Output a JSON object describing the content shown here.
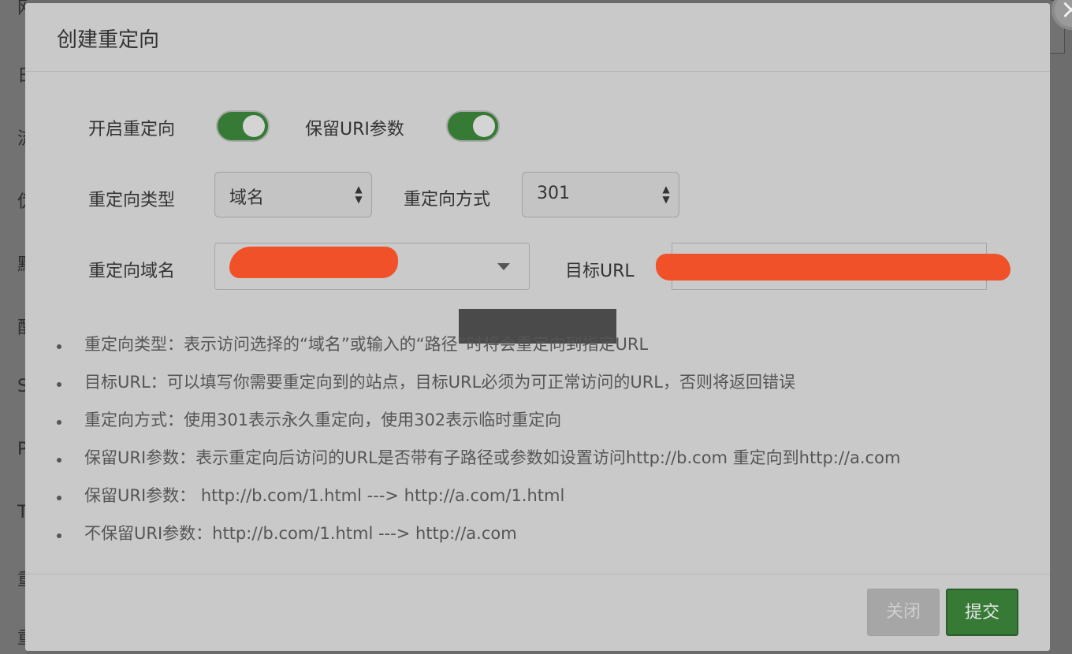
{
  "background": {
    "sidebar_fragments": [
      "网",
      "日",
      "流",
      "伪",
      "默",
      "配",
      "S",
      "P",
      "T",
      "重",
      "重"
    ]
  },
  "modal": {
    "title": "创建重定向",
    "close_icon": "close-icon",
    "fields": {
      "enable_redirect": {
        "label": "开启重定向",
        "on": true
      },
      "keep_uri_params": {
        "label": "保留URI参数",
        "on": true
      },
      "redirect_type": {
        "label": "重定向类型",
        "value": "域名"
      },
      "redirect_method": {
        "label": "重定向方式",
        "value": "301"
      },
      "redirect_domain": {
        "label": "重定向域名",
        "value": ""
      },
      "target_url": {
        "label": "目标URL",
        "value": ""
      }
    },
    "help": [
      "重定向类型：表示访问选择的“域名”或输入的“路径”时将会重定向到指定URL",
      "目标URL：可以填写你需要重定向到的站点，目标URL必须为可正常访问的URL，否则将返回错误",
      "重定向方式：使用301表示永久重定向，使用302表示临时重定向",
      "保留URI参数：表示重定向后访问的URL是否带有子路径或参数如设置访问http://b.com 重定向到http://a.com",
      "保留URI参数：  http://b.com/1.html ---> http://a.com/1.html",
      "不保留URI参数：http://b.com/1.html ---> http://a.com"
    ],
    "buttons": {
      "close": "关闭",
      "submit": "提交"
    }
  },
  "colors": {
    "accent_green": "#367a35",
    "redaction": "#f05129"
  }
}
